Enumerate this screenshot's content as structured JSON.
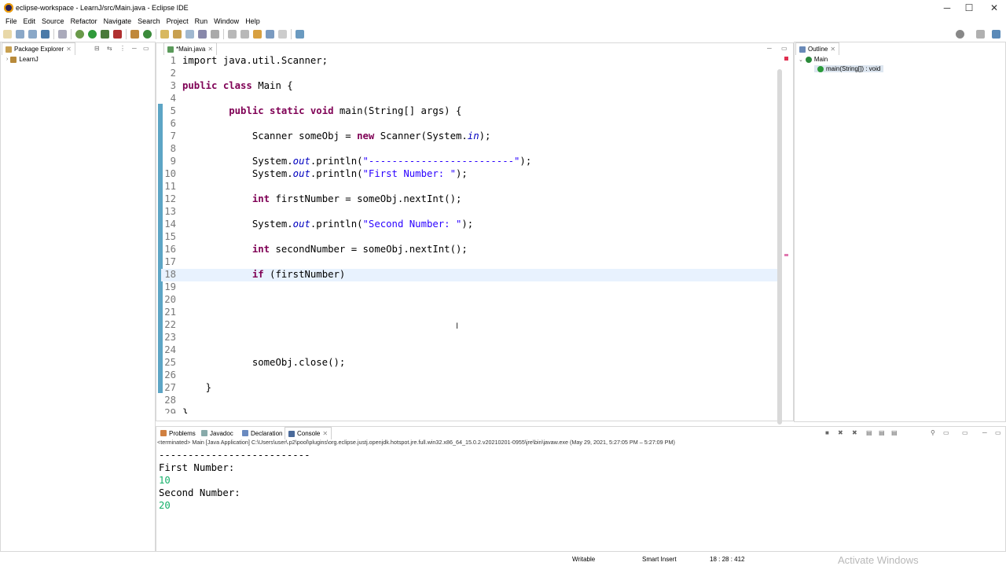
{
  "window": {
    "title": "eclipse-workspace - LearnJ/src/Main.java - Eclipse IDE",
    "min": "─",
    "max": "☐",
    "close": "✕"
  },
  "menu": [
    "File",
    "Edit",
    "Source",
    "Refactor",
    "Navigate",
    "Search",
    "Project",
    "Run",
    "Window",
    "Help"
  ],
  "package_explorer": {
    "tab": "Package Explorer",
    "project": "LearnJ"
  },
  "editor": {
    "tab": "*Main.java"
  },
  "code_lines": [
    [
      {
        "t": "import java.util.Scanner;"
      }
    ],
    [],
    [
      {
        "t": "public class ",
        "c": "kw"
      },
      {
        "t": "Main {"
      }
    ],
    [],
    [
      {
        "t": "        "
      },
      {
        "t": "public static void ",
        "c": "kw"
      },
      {
        "t": "main(String[] args) {"
      }
    ],
    [],
    [
      {
        "t": "            Scanner someObj = "
      },
      {
        "t": "new",
        "c": "kw"
      },
      {
        "t": " Scanner(System."
      },
      {
        "t": "in",
        "c": "fld"
      },
      {
        "t": ");"
      }
    ],
    [],
    [
      {
        "t": "            System."
      },
      {
        "t": "out",
        "c": "fld"
      },
      {
        "t": ".println("
      },
      {
        "t": "\"-------------------------\"",
        "c": "str"
      },
      {
        "t": ");"
      }
    ],
    [
      {
        "t": "            System."
      },
      {
        "t": "out",
        "c": "fld"
      },
      {
        "t": ".println("
      },
      {
        "t": "\"First Number: \"",
        "c": "str"
      },
      {
        "t": ");"
      }
    ],
    [],
    [
      {
        "t": "            "
      },
      {
        "t": "int",
        "c": "kw"
      },
      {
        "t": " firstNumber = someObj.nextInt();"
      }
    ],
    [],
    [
      {
        "t": "            System."
      },
      {
        "t": "out",
        "c": "fld"
      },
      {
        "t": ".println("
      },
      {
        "t": "\"Second Number: \"",
        "c": "str"
      },
      {
        "t": ");"
      }
    ],
    [],
    [
      {
        "t": "            "
      },
      {
        "t": "int",
        "c": "kw"
      },
      {
        "t": " secondNumber = someObj.nextInt();"
      }
    ],
    [],
    [
      {
        "t": "            "
      },
      {
        "t": "if",
        "c": "kw"
      },
      {
        "t": " (firstNumber)"
      }
    ],
    [],
    [],
    [],
    [],
    [],
    [],
    [
      {
        "t": "            someObj.close();"
      }
    ],
    [],
    [
      {
        "t": "    }"
      }
    ],
    [],
    [
      {
        "t": "}"
      }
    ]
  ],
  "outline": {
    "tab": "Outline",
    "class": "Main",
    "method": "main(String[]) : void"
  },
  "bottom_tabs": [
    "Problems",
    "Javadoc",
    "Declaration",
    "Console"
  ],
  "console": {
    "header": "<terminated> Main [Java Application] C:\\Users\\user\\.p2\\pool\\plugins\\org.eclipse.justj.openjdk.hotspot.jre.full.win32.x86_64_15.0.2.v20210201-0955\\jre\\bin\\javaw.exe  (May 29, 2021, 5:27:05 PM – 5:27:09 PM)",
    "lines": [
      {
        "t": "--------------------------",
        "c": ""
      },
      {
        "t": "First Number:",
        "c": ""
      },
      {
        "t": "10",
        "c": "green"
      },
      {
        "t": "Second Number:",
        "c": ""
      },
      {
        "t": "20",
        "c": "green"
      }
    ]
  },
  "status": {
    "writable": "Writable",
    "insert": "Smart Insert",
    "position": "18 : 28 : 412"
  },
  "watermark": "Activate Windows"
}
